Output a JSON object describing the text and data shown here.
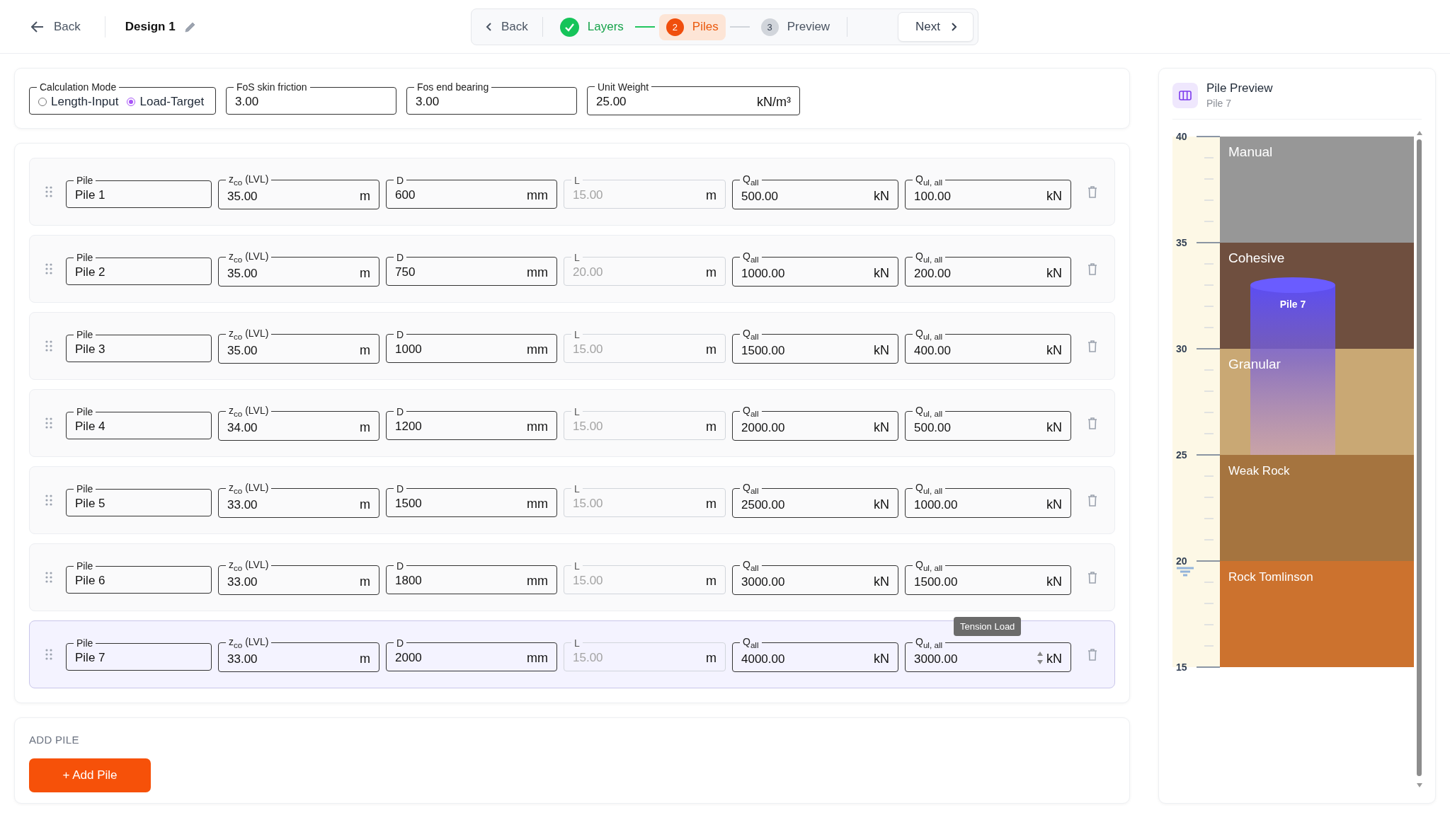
{
  "topbar": {
    "back": "Back",
    "title": "Design 1"
  },
  "stepper": {
    "back": "Back",
    "next": "Next",
    "steps": [
      {
        "label": "Layers",
        "completed": true,
        "selected": false
      },
      {
        "number": "2",
        "label": "Piles",
        "completed": false,
        "selected": true
      },
      {
        "number": "3",
        "label": "Preview",
        "completed": false,
        "selected": false
      }
    ]
  },
  "settings": {
    "mode": {
      "label": "Calculation Mode",
      "options": [
        {
          "label": "Length-Input",
          "selected": false
        },
        {
          "label": "Load-Target",
          "selected": true
        }
      ]
    },
    "fields": [
      {
        "label": "FoS skin friction",
        "value": "3.00"
      },
      {
        "label": "Fos end bearing",
        "value": "3.00"
      },
      {
        "label": "Unit Weight",
        "value": "25.00",
        "unit": "kN/m³"
      }
    ]
  },
  "piles": [
    {
      "selected": false,
      "fields": [
        {
          "label": "Pile",
          "value": "Pile 1",
          "disabled": false
        },
        {
          "label": "z$_{co}$ (LVL)",
          "value": "35.00",
          "unit": "m",
          "disabled": false
        },
        {
          "label": "D",
          "value": "600",
          "unit": "mm",
          "disabled": false
        },
        {
          "label": "L",
          "value": "15.00",
          "unit": "m",
          "disabled": true
        },
        {
          "label": "Q$_{all}$",
          "value": "500.00",
          "unit": "kN",
          "disabled": false
        },
        {
          "label": "Q$_{ul, all}$",
          "value": "100.00",
          "unit": "kN",
          "disabled": false
        }
      ]
    },
    {
      "selected": false,
      "fields": [
        {
          "label": "Pile",
          "value": "Pile 2",
          "disabled": false
        },
        {
          "label": "z$_{co}$ (LVL)",
          "value": "35.00",
          "unit": "m",
          "disabled": false
        },
        {
          "label": "D",
          "value": "750",
          "unit": "mm",
          "disabled": false
        },
        {
          "label": "L",
          "value": "20.00",
          "unit": "m",
          "disabled": true
        },
        {
          "label": "Q$_{all}$",
          "value": "1000.00",
          "unit": "kN",
          "disabled": false
        },
        {
          "label": "Q$_{ul, all}$",
          "value": "200.00",
          "unit": "kN",
          "disabled": false
        }
      ]
    },
    {
      "selected": false,
      "fields": [
        {
          "label": "Pile",
          "value": "Pile 3",
          "disabled": false
        },
        {
          "label": "z$_{co}$ (LVL)",
          "value": "35.00",
          "unit": "m",
          "disabled": false
        },
        {
          "label": "D",
          "value": "1000",
          "unit": "mm",
          "disabled": false
        },
        {
          "label": "L",
          "value": "15.00",
          "unit": "m",
          "disabled": true
        },
        {
          "label": "Q$_{all}$",
          "value": "1500.00",
          "unit": "kN",
          "disabled": false
        },
        {
          "label": "Q$_{ul, all}$",
          "value": "400.00",
          "unit": "kN",
          "disabled": false
        }
      ]
    },
    {
      "selected": false,
      "fields": [
        {
          "label": "Pile",
          "value": "Pile 4",
          "disabled": false
        },
        {
          "label": "z$_{co}$ (LVL)",
          "value": "34.00",
          "unit": "m",
          "disabled": false
        },
        {
          "label": "D",
          "value": "1200",
          "unit": "mm",
          "disabled": false
        },
        {
          "label": "L",
          "value": "15.00",
          "unit": "m",
          "disabled": true
        },
        {
          "label": "Q$_{all}$",
          "value": "2000.00",
          "unit": "kN",
          "disabled": false
        },
        {
          "label": "Q$_{ul, all}$",
          "value": "500.00",
          "unit": "kN",
          "disabled": false
        }
      ]
    },
    {
      "selected": false,
      "fields": [
        {
          "label": "Pile",
          "value": "Pile 5",
          "disabled": false
        },
        {
          "label": "z$_{co}$ (LVL)",
          "value": "33.00",
          "unit": "m",
          "disabled": false
        },
        {
          "label": "D",
          "value": "1500",
          "unit": "mm",
          "disabled": false
        },
        {
          "label": "L",
          "value": "15.00",
          "unit": "m",
          "disabled": true
        },
        {
          "label": "Q$_{all}$",
          "value": "2500.00",
          "unit": "kN",
          "disabled": false
        },
        {
          "label": "Q$_{ul, all}$",
          "value": "1000.00",
          "unit": "kN",
          "disabled": false
        }
      ]
    },
    {
      "selected": false,
      "fields": [
        {
          "label": "Pile",
          "value": "Pile 6",
          "disabled": false
        },
        {
          "label": "z$_{co}$ (LVL)",
          "value": "33.00",
          "unit": "m",
          "disabled": false
        },
        {
          "label": "D",
          "value": "1800",
          "unit": "mm",
          "disabled": false
        },
        {
          "label": "L",
          "value": "15.00",
          "unit": "m",
          "disabled": true
        },
        {
          "label": "Q$_{all}$",
          "value": "3000.00",
          "unit": "kN",
          "disabled": false
        },
        {
          "label": "Q$_{ul, all}$",
          "value": "1500.00",
          "unit": "kN",
          "disabled": false
        }
      ]
    },
    {
      "selected": true,
      "fields": [
        {
          "label": "Pile",
          "value": "Pile 7",
          "disabled": false
        },
        {
          "label": "z$_{co}$ (LVL)",
          "value": "33.00",
          "unit": "m",
          "disabled": false
        },
        {
          "label": "D",
          "value": "2000",
          "unit": "mm",
          "disabled": false
        },
        {
          "label": "L",
          "value": "15.00",
          "unit": "m",
          "disabled": true
        },
        {
          "label": "Q$_{all}$",
          "value": "4000.00",
          "unit": "kN",
          "disabled": false
        },
        {
          "label": "Q$_{ul, all}$",
          "value": "3000.00",
          "unit": "kN",
          "disabled": false,
          "tooltip": "Tension Load"
        }
      ]
    }
  ],
  "add_pile": {
    "heading": "ADD PILE",
    "button": "+ Add Pile"
  },
  "preview": {
    "title": "Pile Preview",
    "subtitle": "Pile 7",
    "pile_label": "Pile 7",
    "ticks": [
      "40",
      "35",
      "30",
      "25",
      "20",
      "15"
    ],
    "layers": [
      {
        "name": "Manual",
        "color": "#979797"
      },
      {
        "name": "Cohesive",
        "color": "#6f4f3f"
      },
      {
        "name": "Granular",
        "color": "#c9a874"
      },
      {
        "name": "Weak Rock",
        "color": "#a5743f"
      },
      {
        "name": "Rock Tomlinson",
        "color": "#cc722e"
      }
    ]
  }
}
